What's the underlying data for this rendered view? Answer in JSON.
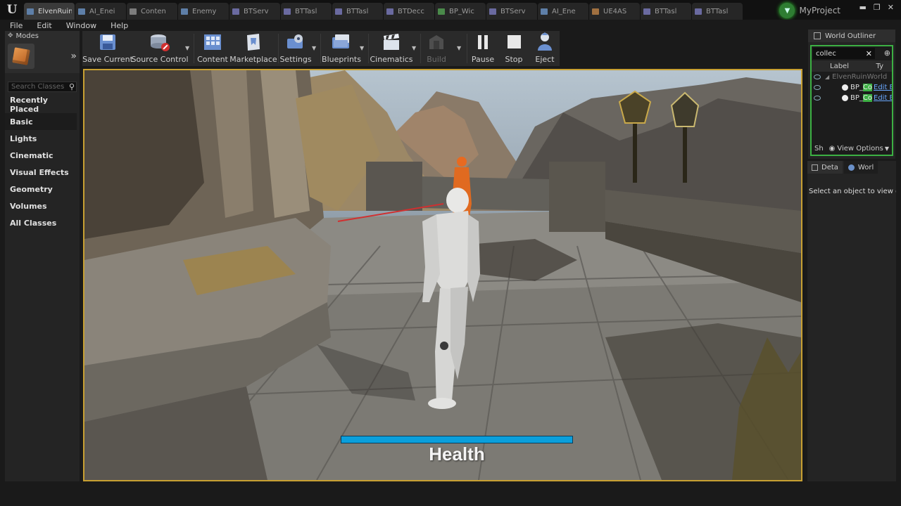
{
  "tabs": [
    {
      "label": "ElvenRuin",
      "icon": "level-icon",
      "active": true
    },
    {
      "label": "AI_Enei",
      "icon": "blueprint-icon"
    },
    {
      "label": "Conten",
      "icon": "content-browser-icon"
    },
    {
      "label": "Enemy",
      "icon": "blueprint-icon"
    },
    {
      "label": "BTServ",
      "icon": "blueprint-icon"
    },
    {
      "label": "BTTasl",
      "icon": "blueprint-icon"
    },
    {
      "label": "BTTasl",
      "icon": "blueprint-icon"
    },
    {
      "label": "BTDecc",
      "icon": "blueprint-icon"
    },
    {
      "label": "BP_Wic",
      "icon": "widget-icon"
    },
    {
      "label": "BTServ",
      "icon": "blueprint-icon"
    },
    {
      "label": "AI_Ene",
      "icon": "blueprint-icon"
    },
    {
      "label": "UE4AS",
      "icon": "animation-icon"
    },
    {
      "label": "BTTasl",
      "icon": "blueprint-icon"
    },
    {
      "label": "BTTasl",
      "icon": "blueprint-icon"
    }
  ],
  "project": {
    "name": "MyProject"
  },
  "menu": {
    "file": "File",
    "edit": "Edit",
    "window": "Window",
    "help": "Help"
  },
  "modes": {
    "tab_label": "Modes",
    "search_placeholder": "Search Classes",
    "categories": [
      "Recently Placed",
      "Basic",
      "Lights",
      "Cinematic",
      "Visual Effects",
      "Geometry",
      "Volumes",
      "All Classes"
    ],
    "active_category": "Basic"
  },
  "toolbar": {
    "save_current": "Save Current",
    "source_control": "Source Control",
    "content": "Content",
    "marketplace": "Marketplace",
    "settings": "Settings",
    "blueprints": "Blueprints",
    "cinematics": "Cinematics",
    "build": "Build",
    "pause": "Pause",
    "stop": "Stop",
    "eject": "Eject"
  },
  "hud": {
    "health_label": "Health",
    "health_fraction": 1.0
  },
  "outliner": {
    "tab_label": "World Outliner",
    "search_value": "collec",
    "col_label": "Label",
    "col_type": "Ty",
    "world_name": "ElvenRuinWorld",
    "rows": [
      {
        "prefix": "BP_",
        "highlight": "Co",
        "link": "Edit B"
      },
      {
        "prefix": "BP_",
        "highlight": "Co",
        "link": "Edit B"
      }
    ],
    "footer_left": "Sh",
    "view_options": "View Options"
  },
  "details": {
    "tab_details": "Deta",
    "tab_world": "Worl",
    "message": "Select an object to view de"
  },
  "colors": {
    "accent_viewport_border": "#c8a032",
    "outliner_highlight": "#3cb043",
    "health_bar": "#0a9fdc"
  }
}
